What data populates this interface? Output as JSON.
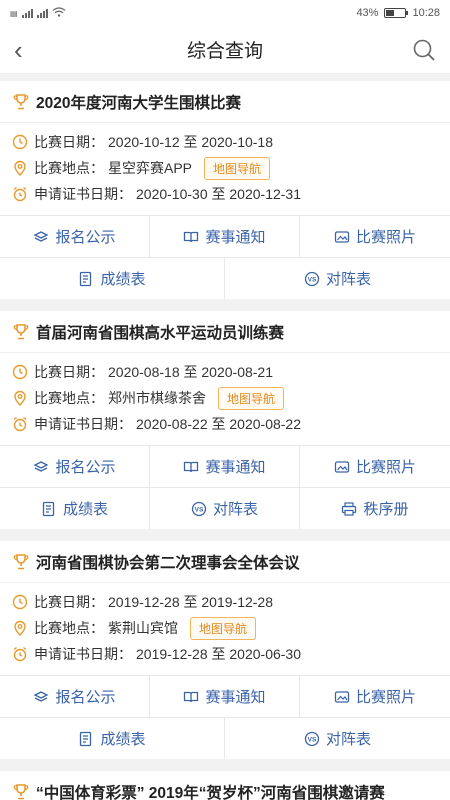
{
  "statusbar": {
    "battery": "43%",
    "time": "10:28",
    "battery_level": 0.43
  },
  "header": {
    "title": "综合查询"
  },
  "colors": {
    "accent": "#3a63a8",
    "orange": "#e99a2c",
    "tag_border": "#f0b45a"
  },
  "cards": [
    {
      "title": "2020年度河南大学生围棋比赛",
      "date_label": "比赛日期：",
      "date_value": "2020-10-12 至 2020-10-18",
      "venue_label": "比赛地点：",
      "venue_value": "星空弈赛APP",
      "nav_label": "地图导航",
      "cert_label": "申请证书日期：",
      "cert_value": "2020-10-30 至 2020-12-31",
      "actions_row1": [
        "报名公示",
        "赛事通知",
        "比赛照片"
      ],
      "actions_row2": [
        "成绩表",
        "对阵表"
      ]
    },
    {
      "title": "首届河南省围棋高水平运动员训练赛",
      "date_label": "比赛日期：",
      "date_value": "2020-08-18 至 2020-08-21",
      "venue_label": "比赛地点：",
      "venue_value": "郑州市棋缘茶舍",
      "nav_label": "地图导航",
      "cert_label": "申请证书日期：",
      "cert_value": "2020-08-22 至 2020-08-22",
      "actions_row1": [
        "报名公示",
        "赛事通知",
        "比赛照片"
      ],
      "actions_row2": [
        "成绩表",
        "对阵表",
        "秩序册"
      ]
    },
    {
      "title": "河南省围棋协会第二次理事会全体会议",
      "date_label": "比赛日期：",
      "date_value": "2019-12-28 至 2019-12-28",
      "venue_label": "比赛地点：",
      "venue_value": "紫荆山宾馆",
      "nav_label": "地图导航",
      "cert_label": "申请证书日期：",
      "cert_value": "2019-12-28 至 2020-06-30",
      "actions_row1": [
        "报名公示",
        "赛事通知",
        "比赛照片"
      ],
      "actions_row2": [
        "成绩表",
        "对阵表"
      ]
    },
    {
      "title": "“中国体育彩票” 2019年“贺岁杯”河南省围棋邀请赛"
    }
  ]
}
